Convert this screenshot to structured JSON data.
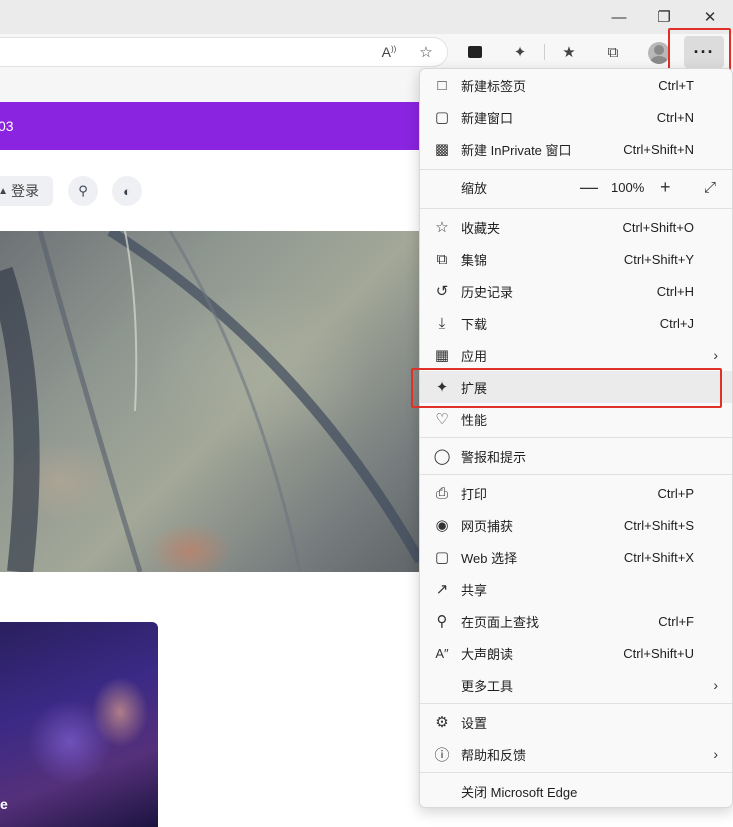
{
  "window": {
    "minimize_icon": "minimize-icon",
    "restore_icon": "restore-icon",
    "close_icon": "close-icon"
  },
  "toolbar": {
    "read_aloud_icon": "read-aloud-icon",
    "add_favorite_icon": "star-add-icon",
    "extensions_icon": "puzzle-icon",
    "favorites_icon": "favorites-icon",
    "collections_icon": "collections-icon",
    "more_label": "···"
  },
  "page": {
    "banner_text": "03",
    "login_label": "登录",
    "card_caption": "e"
  },
  "menu": {
    "items": [
      {
        "label": "新建标签页",
        "shortcut": "Ctrl+T",
        "icon": "new-tab-icon"
      },
      {
        "label": "新建窗口",
        "shortcut": "Ctrl+N",
        "icon": "new-window-icon"
      },
      {
        "label": "新建 InPrivate 窗口",
        "shortcut": "Ctrl+Shift+N",
        "icon": "inprivate-icon"
      },
      {
        "label": "缩放",
        "zoom_value": "100%",
        "icon": ""
      },
      {
        "label": "收藏夹",
        "shortcut": "Ctrl+Shift+O",
        "icon": "favorites-icon"
      },
      {
        "label": "集锦",
        "shortcut": "Ctrl+Shift+Y",
        "icon": "collections-icon"
      },
      {
        "label": "历史记录",
        "shortcut": "Ctrl+H",
        "icon": "history-icon"
      },
      {
        "label": "下载",
        "shortcut": "Ctrl+J",
        "icon": "download-icon"
      },
      {
        "label": "应用",
        "shortcut": "",
        "icon": "apps-icon"
      },
      {
        "label": "扩展",
        "shortcut": "",
        "icon": "puzzle-icon"
      },
      {
        "label": "性能",
        "shortcut": "",
        "icon": "performance-icon"
      },
      {
        "label": "警报和提示",
        "shortcut": "",
        "icon": "bell-icon"
      },
      {
        "label": "打印",
        "shortcut": "Ctrl+P",
        "icon": "print-icon"
      },
      {
        "label": "网页捕获",
        "shortcut": "Ctrl+Shift+S",
        "icon": "capture-icon"
      },
      {
        "label": "Web 选择",
        "shortcut": "Ctrl+Shift+X",
        "icon": "web-select-icon"
      },
      {
        "label": "共享",
        "shortcut": "",
        "icon": "share-icon"
      },
      {
        "label": "在页面上查找",
        "shortcut": "Ctrl+F",
        "icon": "find-icon"
      },
      {
        "label": "大声朗读",
        "shortcut": "Ctrl+Shift+U",
        "icon": "read-aloud-icon"
      },
      {
        "label": "更多工具",
        "shortcut": "",
        "icon": ""
      },
      {
        "label": "设置",
        "shortcut": "",
        "icon": "gear-icon"
      },
      {
        "label": "帮助和反馈",
        "shortcut": "",
        "icon": "help-icon"
      },
      {
        "label": "关闭 Microsoft Edge",
        "shortcut": "",
        "icon": ""
      }
    ]
  },
  "colors": {
    "accent_purple": "#8a24e0",
    "highlight_red": "#e0302a"
  }
}
